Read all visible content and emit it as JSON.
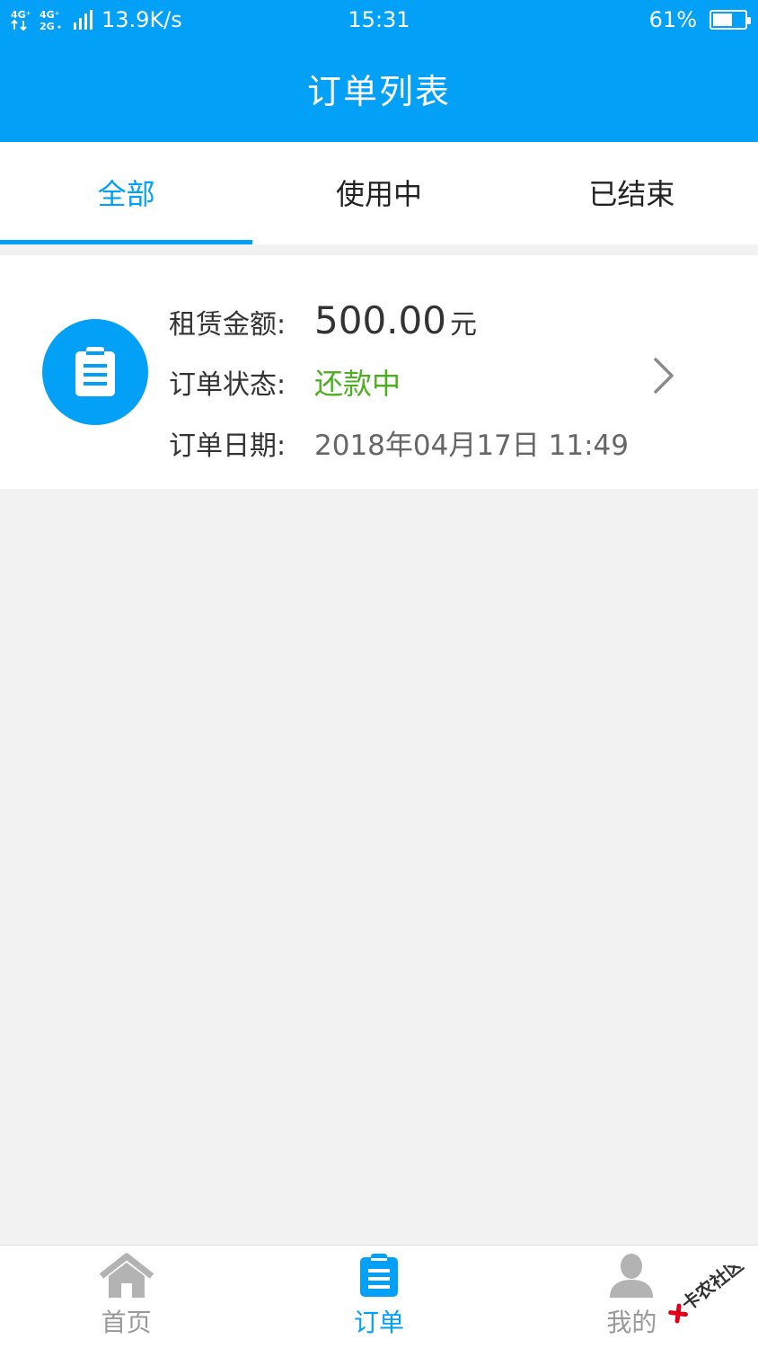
{
  "status_bar": {
    "network_badge_1": "4G⁺",
    "network_badge_2": "4G⁺ 2G",
    "speed": "13.9K/s",
    "time": "15:31",
    "battery_percent": "61%",
    "battery_level": 0.61
  },
  "header": {
    "title": "订单列表"
  },
  "tabs": [
    {
      "label": "全部",
      "active": true
    },
    {
      "label": "使用中",
      "active": false
    },
    {
      "label": "已结束",
      "active": false
    }
  ],
  "order": {
    "amount_label": "租赁金额:",
    "amount": "500.00",
    "amount_unit": "元",
    "status_label": "订单状态:",
    "status": "还款中",
    "date_label": "订单日期:",
    "date": "2018年04月17日 11:49",
    "icon": "clipboard-icon"
  },
  "bottom_nav": [
    {
      "label": "首页",
      "icon": "home-icon",
      "active": false
    },
    {
      "label": "订单",
      "icon": "clipboard-icon",
      "active": true
    },
    {
      "label": "我的",
      "icon": "user-icon",
      "active": false
    }
  ],
  "watermark": {
    "text": "卡农社区"
  },
  "colors": {
    "primary": "#03a0f7",
    "status_green": "#4caf1f",
    "background": "#f2f2f2",
    "inactive": "#999999"
  }
}
